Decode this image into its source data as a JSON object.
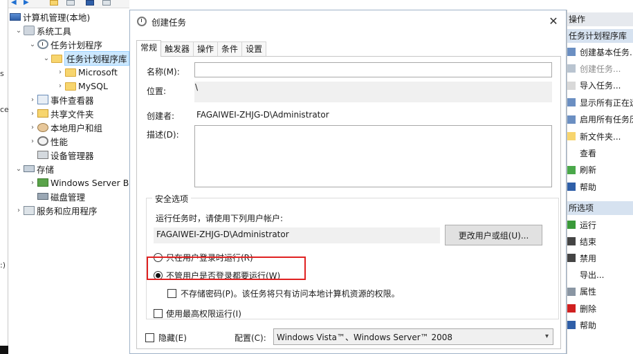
{
  "left_strip": {
    "frag_top": "s",
    "frag_mid": "ce",
    "frag_bot": ":)"
  },
  "tree": [
    {
      "label": "计算机管理(本地)",
      "icon": "computer-icon",
      "level": 0,
      "expand": "",
      "key": "computer"
    },
    {
      "label": "系统工具",
      "icon": "tools-icon",
      "level": 1,
      "expand": "v",
      "key": "systools"
    },
    {
      "label": "任务计划程序",
      "icon": "clock-icon",
      "level": 2,
      "expand": "v",
      "key": "scheduler"
    },
    {
      "label": "任务计划程序库",
      "icon": "folder-icon",
      "level": 3,
      "expand": "v",
      "key": "library",
      "selected": true
    },
    {
      "label": "Microsoft",
      "icon": "folder-icon",
      "level": 4,
      "expand": ">",
      "key": "microsoft"
    },
    {
      "label": "MySQL",
      "icon": "folder-icon",
      "level": 4,
      "expand": ">",
      "key": "mysql"
    },
    {
      "label": "事件查看器",
      "icon": "event-log-icon",
      "level": 2,
      "expand": ">",
      "key": "events"
    },
    {
      "label": "共享文件夹",
      "icon": "shared-folder-icon",
      "level": 2,
      "expand": ">",
      "key": "shares"
    },
    {
      "label": "本地用户和组",
      "icon": "users-icon",
      "level": 2,
      "expand": ">",
      "key": "users"
    },
    {
      "label": "性能",
      "icon": "performance-icon",
      "level": 2,
      "expand": ">",
      "key": "perf"
    },
    {
      "label": "设备管理器",
      "icon": "device-manager-icon",
      "level": 2,
      "expand": "",
      "key": "devices"
    },
    {
      "label": "存储",
      "icon": "storage-icon",
      "level": 1,
      "expand": "v",
      "key": "storage"
    },
    {
      "label": "Windows Server Ba",
      "icon": "backup-icon",
      "level": 2,
      "expand": ">",
      "key": "wsb"
    },
    {
      "label": "磁盘管理",
      "icon": "disk-icon",
      "level": 2,
      "expand": "",
      "key": "disk"
    },
    {
      "label": "服务和应用程序",
      "icon": "services-icon",
      "level": 1,
      "expand": ">",
      "key": "services"
    }
  ],
  "dialog": {
    "title": "创建任务",
    "close_symbol": "✕",
    "tabs": [
      {
        "label": "常规",
        "active": true
      },
      {
        "label": "触发器",
        "active": false
      },
      {
        "label": "操作",
        "active": false
      },
      {
        "label": "条件",
        "active": false
      },
      {
        "label": "设置",
        "active": false
      }
    ],
    "general": {
      "name_label": "名称(M):",
      "name_value": "",
      "location_label": "位置:",
      "location_value": "\\",
      "author_label": "创建者:",
      "author_value": "FAGAIWEI-ZHJG-D\\Administrator",
      "description_label": "描述(D):",
      "description_value": ""
    },
    "security": {
      "group_title": "安全选项",
      "run_as_text": "运行任务时，请使用下列用户帐户:",
      "user_account": "FAGAIWEI-ZHJG-D\\Administrator",
      "change_user_button": "更改用户或组(U)...",
      "radio_logged_on": "只在用户登录时运行(R)",
      "radio_whether": "不管用户是否登录都要运行(W)",
      "no_store_password": "不存储密码(P)。该任务将只有访问本地计算机资源的权限。",
      "highest_privileges": "使用最高权限运行(I)",
      "selected_radio": "whether"
    },
    "bottom": {
      "hidden_label": "隐藏(E)",
      "configure_label": "配置(C):",
      "configure_value": "Windows Vista™、Windows Server™ 2008"
    }
  },
  "actions": {
    "header": "操作",
    "sub_header": "任务计划程序库",
    "items": [
      {
        "label": "创建基本任务...",
        "icon": "create-basic-task-icon",
        "enabled": true
      },
      {
        "label": "创建任务...",
        "icon": "create-task-icon",
        "enabled": false
      },
      {
        "label": "导入任务...",
        "icon": "import-icon",
        "enabled": true
      },
      {
        "label": "显示所有正在运",
        "icon": "running-tasks-icon",
        "enabled": true
      },
      {
        "label": "启用所有任务历",
        "icon": "history-icon",
        "enabled": true
      },
      {
        "label": "新文件夹...",
        "icon": "new-folder-icon",
        "enabled": true
      },
      {
        "label": "查看",
        "icon": "view-icon",
        "enabled": true
      },
      {
        "label": "刷新",
        "icon": "refresh-icon",
        "enabled": true
      },
      {
        "label": "帮助",
        "icon": "help-icon",
        "enabled": true
      }
    ],
    "selected_header": "所选项",
    "selected_items": [
      {
        "label": "运行",
        "icon": "run-icon"
      },
      {
        "label": "结束",
        "icon": "end-icon"
      },
      {
        "label": "禁用",
        "icon": "disable-icon"
      },
      {
        "label": "导出...",
        "icon": "export-icon"
      },
      {
        "label": "属性",
        "icon": "properties-icon"
      },
      {
        "label": "删除",
        "icon": "delete-icon"
      },
      {
        "label": "帮助",
        "icon": "help-icon"
      }
    ]
  },
  "colors": {
    "highlight_border": "#e02020",
    "selection_bg": "#cce8ff",
    "actions_header_bg": "#e6e9ee"
  }
}
